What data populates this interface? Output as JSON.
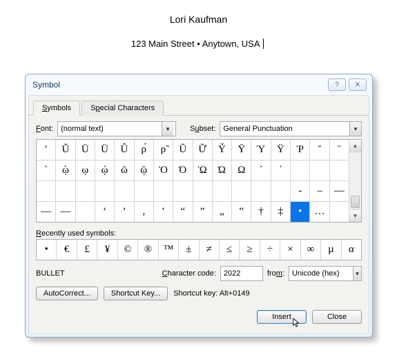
{
  "document": {
    "author": "Lori Kaufman",
    "address": "123 Main Street • Anytown, USA"
  },
  "dialog": {
    "title": "Symbol",
    "tabs": {
      "symbols": "Symbols",
      "special": "Special Characters"
    },
    "font_label": "Font:",
    "font_value": "(normal text)",
    "subset_label": "Subset:",
    "subset_value": "General Punctuation",
    "grid": [
      [
        "ʹ",
        "Ŭ",
        "Ū",
        "Ü",
        "Û",
        "ρ́",
        "ρ̃",
        "Ũ",
        "Ữ",
        "Y̌",
        "Ȳ",
        "Ύ",
        "Ϋ",
        "Ῥ",
        "˘",
        "ˉ"
      ],
      [
        "`",
        "ῲ",
        "ῳ",
        "ῴ",
        "ῶ",
        "ῷ",
        "Ὸ",
        "Ό",
        "Ὼ",
        "Ώ",
        "Ω",
        "´",
        "῾",
        " ",
        " ",
        " "
      ],
      [
        " ",
        " ",
        " ",
        " ",
        " ",
        " ",
        " ",
        " ",
        " ",
        " ",
        " ",
        " ",
        " ",
        "-",
        "–",
        "—"
      ],
      [
        "―",
        "—",
        " ",
        "‘",
        "’",
        "‚",
        "‛",
        "“",
        "”",
        "„",
        "‟",
        "†",
        "‡",
        "•",
        "…",
        " "
      ]
    ],
    "selected": {
      "row": 3,
      "col": 13
    },
    "recent_label": "Recently used symbols:",
    "recent": [
      "•",
      "€",
      "£",
      "¥",
      "©",
      "®",
      "™",
      "±",
      "≠",
      "≤",
      "≥",
      "÷",
      "×",
      "∞",
      "µ",
      "α"
    ],
    "char_name": "BULLET",
    "code_label": "Character code:",
    "code_value": "2022",
    "from_label": "from:",
    "from_value": "Unicode (hex)",
    "autocorrect_btn": "AutoCorrect...",
    "shortcut_btn": "Shortcut Key...",
    "shortcut_text": "Shortcut key: Alt+0149",
    "insert_btn": "Insert",
    "close_btn": "Close"
  }
}
